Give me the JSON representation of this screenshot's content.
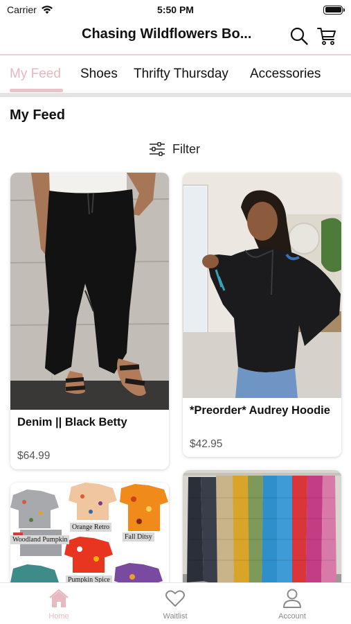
{
  "status_bar": {
    "carrier": "Carrier",
    "time": "5:50 PM"
  },
  "header": {
    "title": "Chasing Wildflowers Bo..."
  },
  "tabs": [
    {
      "label": "My Feed",
      "active": true
    },
    {
      "label": "Shoes",
      "active": false
    },
    {
      "label": "Thrifty Thursday",
      "active": false
    },
    {
      "label": "Accessories",
      "active": false
    }
  ],
  "feed": {
    "title": "My Feed",
    "filter_label": "Filter"
  },
  "products": [
    {
      "title": "Denim || Black Betty",
      "price": "$64.99"
    },
    {
      "title": "*Preorder* Audrey Hoodie",
      "price": "$42.95"
    },
    {
      "title": "",
      "price": ""
    },
    {
      "title": "",
      "price": ""
    }
  ],
  "pajama_labels": [
    "Woodland Pumpkin",
    "Orange Retro",
    "Fall Ditsy",
    "Pumpkin Spice"
  ],
  "bottom_nav": [
    {
      "label": "Home",
      "icon": "home-icon",
      "active": true
    },
    {
      "label": "Waitlist",
      "icon": "heart-icon",
      "active": false
    },
    {
      "label": "Account",
      "icon": "user-icon",
      "active": false
    }
  ],
  "colors": {
    "accent": "#e4b7bf",
    "tab_indicator": "#e7c2c9",
    "header_divider": "#e9d2d6"
  }
}
